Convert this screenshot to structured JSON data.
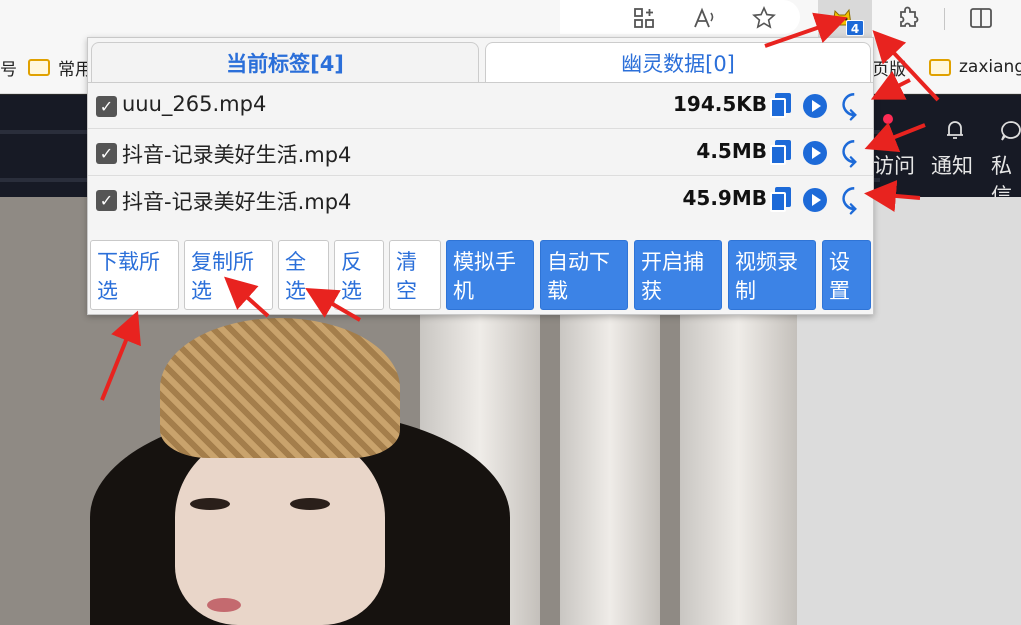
{
  "toolbar": {
    "ext_badge": "4"
  },
  "bookmarks": {
    "left_partial": "号",
    "folder1": "常用",
    "folder2_partial": "页版",
    "folder3": "zaxiang"
  },
  "site": {
    "nav_visit": "访问",
    "nav_notify": "通知",
    "nav_msg": "私信"
  },
  "popup": {
    "tabs": [
      {
        "label": "当前标签[4]"
      },
      {
        "label": "幽灵数据[0]"
      }
    ],
    "files": [
      {
        "name": "uuu_265.mp4",
        "size": "194.5KB",
        "checked": true
      },
      {
        "name": "抖音-记录美好生活.mp4",
        "size": "4.5MB",
        "checked": true
      },
      {
        "name": "抖音-记录美好生活.mp4",
        "size": "45.9MB",
        "checked": true
      }
    ],
    "buttons": [
      {
        "label": "下载所选"
      },
      {
        "label": "复制所选"
      },
      {
        "label": "全选"
      },
      {
        "label": "反选"
      },
      {
        "label": "清空"
      },
      {
        "label": "模拟手机"
      },
      {
        "label": "自动下载"
      },
      {
        "label": "开启捕获"
      },
      {
        "label": "视频录制"
      },
      {
        "label": "设置"
      }
    ]
  },
  "colors": {
    "accent": "#1d6ad8",
    "annotation": "#e8231f"
  }
}
